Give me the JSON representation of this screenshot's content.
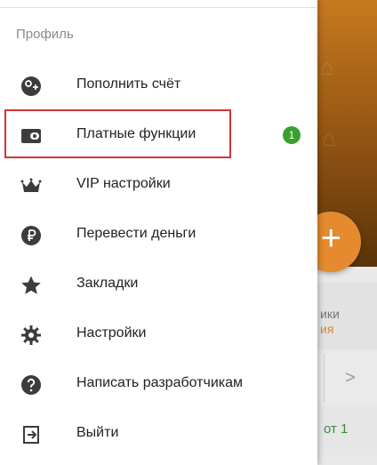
{
  "drawer": {
    "section_title": "Профиль",
    "items": [
      {
        "label": "Пополнить счёт",
        "icon": "coins-plus-icon"
      },
      {
        "label": "Платные функции",
        "icon": "wallet-icon",
        "badge": "1"
      },
      {
        "label": "VIP настройки",
        "icon": "crown-icon"
      },
      {
        "label": "Перевести деньги",
        "icon": "ruble-icon"
      },
      {
        "label": "Закладки",
        "icon": "star-icon"
      },
      {
        "label": "Настройки",
        "icon": "gear-icon"
      },
      {
        "label": "Написать разработчикам",
        "icon": "help-icon"
      },
      {
        "label": "Выйти",
        "icon": "logout-icon"
      }
    ]
  },
  "background": {
    "text1": "ики",
    "text2": "ия",
    "green_text": "от 1"
  },
  "colors": {
    "highlight": "#d3333a",
    "badge": "#3a9f2e",
    "accent": "#e58a2e",
    "icon": "#3c3c3c"
  }
}
